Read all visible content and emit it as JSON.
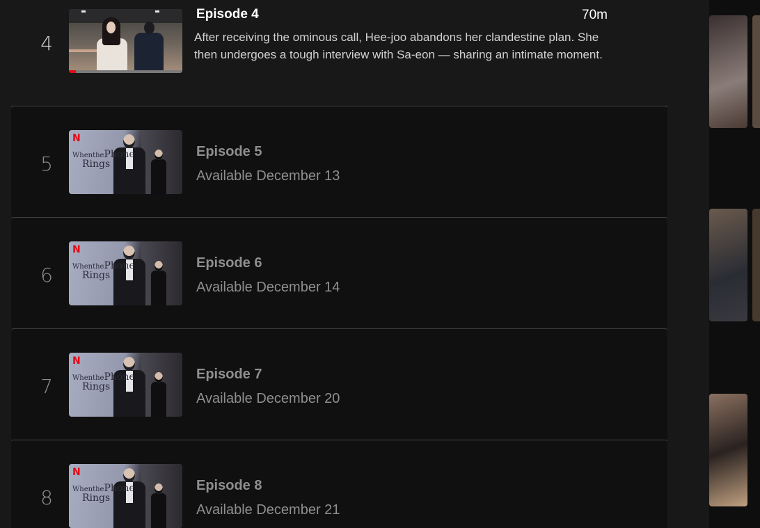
{
  "episodes": [
    {
      "number": "4",
      "title": "Episode 4",
      "duration": "70m",
      "description": "After receiving the ominous call, Hee-joo abandons her clandestine plan. She then undergoes a tough interview with Sa-eon — sharing an intimate moment.",
      "progress_fraction": 0.06,
      "state": "current"
    },
    {
      "number": "5",
      "title": "Episode 5",
      "availability": "Available December 13",
      "state": "upcoming"
    },
    {
      "number": "6",
      "title": "Episode 6",
      "availability": "Available December 14",
      "state": "upcoming"
    },
    {
      "number": "7",
      "title": "Episode 7",
      "availability": "Available December 20",
      "state": "upcoming"
    },
    {
      "number": "8",
      "title": "Episode 8",
      "availability": "Available December 21",
      "state": "upcoming"
    }
  ],
  "poster": {
    "brand_mark": "N",
    "title_line1_small": "When",
    "title_line1_small2": "the",
    "title_line1": "Phone",
    "title_line2": "Rings"
  },
  "colors": {
    "accent": "#e50914",
    "modal_bg": "#181818",
    "row_bg": "#101010",
    "divider": "#404040",
    "muted_text": "#8f8f8f"
  }
}
